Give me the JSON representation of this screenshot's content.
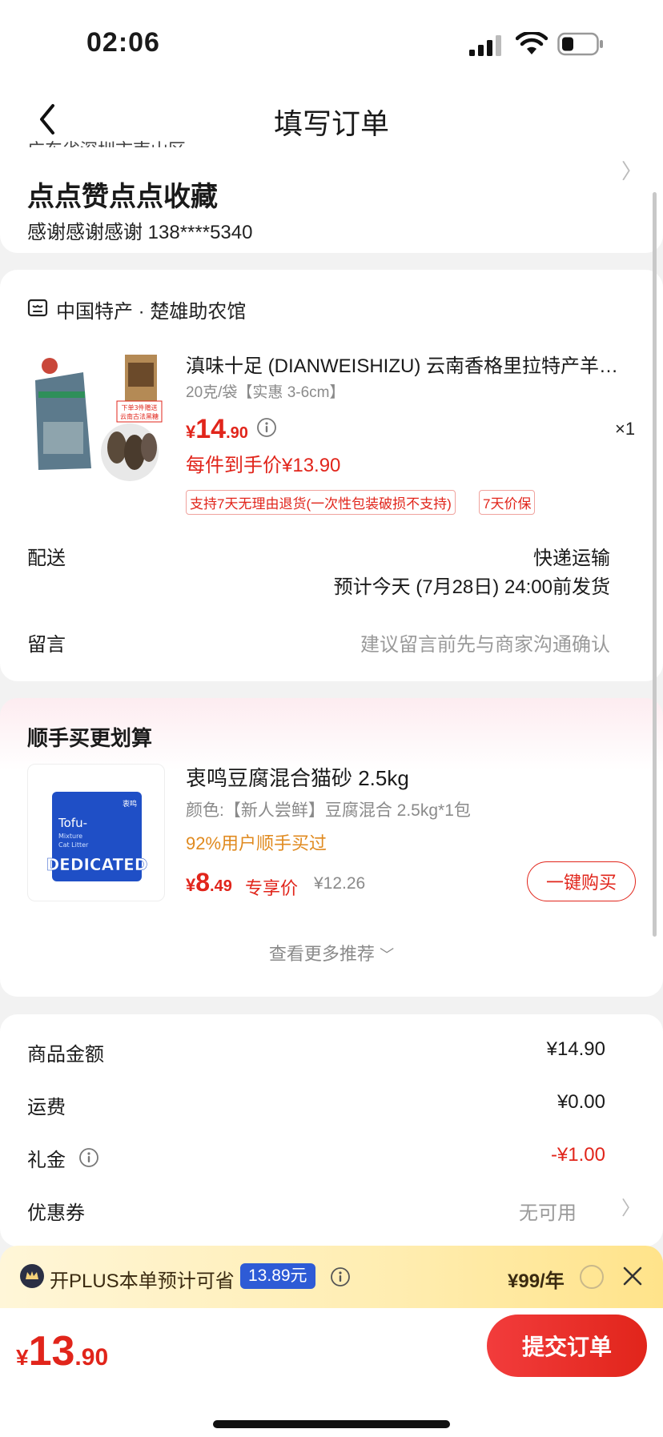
{
  "status_bar": {
    "time": "02:06"
  },
  "nav": {
    "title": "填写订单"
  },
  "address": {
    "cut_text": "广东省深圳市南山区",
    "name": "点点赞点点收藏",
    "contact": "感谢感谢感谢  138****5340"
  },
  "shop": {
    "name": "中国特产 · 楚雄助农馆",
    "product": {
      "title": "滇味十足 (DIANWEISHIZU) 云南香格里拉特产羊肚菌",
      "spec": "20克/袋【实惠 3-6cm】",
      "price_currency": "¥",
      "price_int": "14",
      "price_dec": ".90",
      "qty": "×1",
      "unit_price": "每件到手价¥13.90",
      "tags": [
        "支持7天无理由退货(一次性包装破损不支持)",
        "7天价保"
      ],
      "image_caption": "下单3件赠送云南古法黑糖"
    },
    "shipping_label": "配送",
    "shipping_method": "快递运输",
    "shipping_eta": "预计今天 (7月28日) 24:00前发货",
    "message_label": "留言",
    "message_placeholder": "建议留言前先与商家沟通确认"
  },
  "recommend": {
    "title": "顺手买更划算",
    "item": {
      "name": "衷鸣豆腐混合猫砂 2.5kg",
      "spec": "颜色:【新人尝鲜】豆腐混合 2.5kg*1包",
      "buyers": "92%用户顺手买过",
      "price_currency": "¥",
      "price_int": "8",
      "price_dec": ".49",
      "exclusive": "专享价",
      "original": "¥12.26",
      "buy_label": "一键购买",
      "image_text_main": "DEDICATED",
      "image_text_sub": "Tofu-",
      "image_text_sub2": "Mixture",
      "image_text_sub3": "Cat Litter",
      "image_brand": "衷鸣"
    },
    "more_label": "查看更多推荐"
  },
  "summary": [
    {
      "label": "商品金额",
      "value": "¥14.90",
      "style": "normal"
    },
    {
      "label": "运费",
      "value": "¥0.00",
      "style": "normal"
    },
    {
      "label": "礼金",
      "value": "-¥1.00",
      "style": "red"
    },
    {
      "label": "优惠券",
      "value": "无可用",
      "style": "gray"
    }
  ],
  "plus": {
    "text": "开PLUS本单预计可省",
    "saving": "13.89元",
    "price": "¥99/年"
  },
  "bottom": {
    "total_currency": "¥",
    "total_int": "13",
    "total_dec": ".90",
    "submit_label": "提交订单"
  },
  "colors": {
    "accent_red": "#e1251b",
    "plus_blue": "#2e5bd6",
    "buyers_orange": "#e08a1f"
  }
}
